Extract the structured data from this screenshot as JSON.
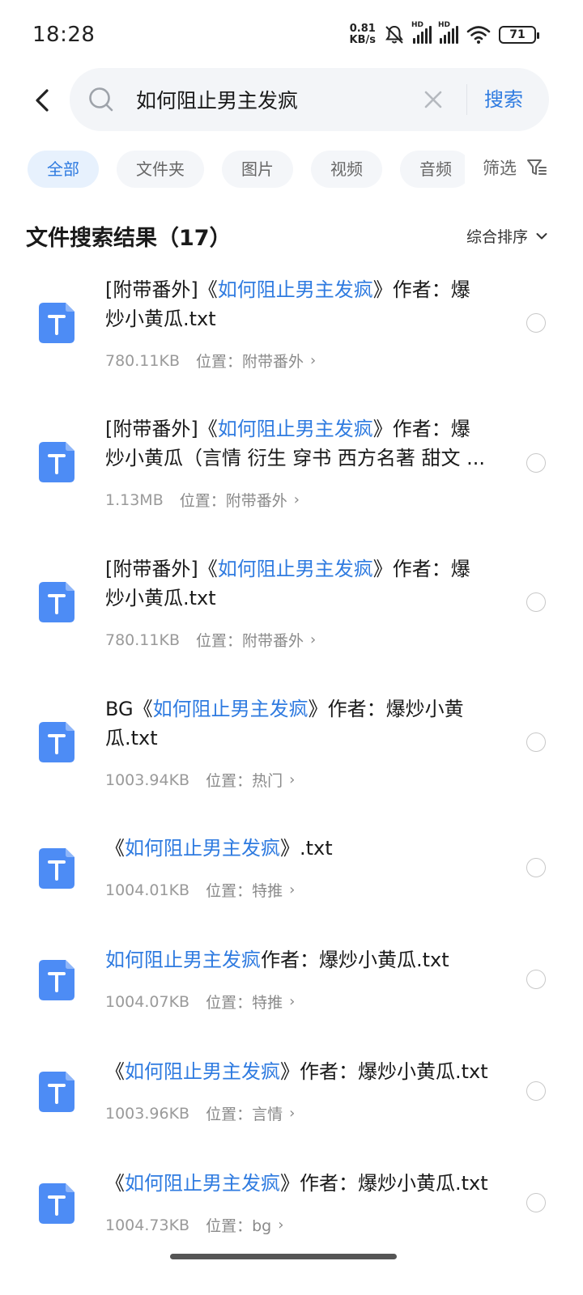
{
  "status_bar": {
    "time": "18:28",
    "net_speed_value": "0.81",
    "net_speed_unit": "KB/s",
    "hd1": "HD",
    "hd2": "HD",
    "battery": "71"
  },
  "search": {
    "query": "如何阻止男主发疯",
    "button_label": "搜索"
  },
  "tabs": [
    {
      "label": "全部",
      "active": true
    },
    {
      "label": "文件夹",
      "active": false
    },
    {
      "label": "图片",
      "active": false
    },
    {
      "label": "视频",
      "active": false
    },
    {
      "label": "音频",
      "active": false
    }
  ],
  "filter_label": "筛选",
  "results": {
    "title": "文件搜索结果（17）",
    "sort_label": "综合排序"
  },
  "colors": {
    "accent": "#2f7be0",
    "file_icon": "#4d8cf5"
  },
  "items": [
    {
      "title_line1_pre": "[附带番外]《",
      "title_line1_hl": "如何阻止男主发疯",
      "title_line1_post": "》作者：爆",
      "title_line2": "炒小黄瓜.txt",
      "size": "780.11KB",
      "location": "位置：附带番外"
    },
    {
      "title_line1_pre": "[附带番外]《",
      "title_line1_hl": "如何阻止男主发疯",
      "title_line1_post": "》作者：爆",
      "title_line2": "炒小黄瓜（言情 衍生 穿书 西方名著 甜文 ...",
      "size": "1.13MB",
      "location": "位置：附带番外"
    },
    {
      "title_line1_pre": "[附带番外]《",
      "title_line1_hl": "如何阻止男主发疯",
      "title_line1_post": "》作者：爆",
      "title_line2": "炒小黄瓜.txt",
      "size": "780.11KB",
      "location": "位置：附带番外"
    },
    {
      "title_line1_pre": "BG《",
      "title_line1_hl": "如何阻止男主发疯",
      "title_line1_post": "》作者：爆炒小黄",
      "title_line2": "瓜.txt",
      "size": "1003.94KB",
      "location": "位置：热门"
    },
    {
      "title_line1_pre": "《",
      "title_line1_hl": "如何阻止男主发疯",
      "title_line1_post": "》.txt",
      "title_line2": "",
      "size": "1004.01KB",
      "location": "位置：特推"
    },
    {
      "title_line1_pre": "",
      "title_line1_hl": "如何阻止男主发疯",
      "title_line1_post": "作者：爆炒小黄瓜.txt",
      "title_line2": "",
      "size": "1004.07KB",
      "location": "位置：特推"
    },
    {
      "title_line1_pre": "《",
      "title_line1_hl": "如何阻止男主发疯",
      "title_line1_post": "》作者：爆炒小黄瓜.txt",
      "title_line2": "",
      "size": "1003.96KB",
      "location": "位置：言情"
    },
    {
      "title_line1_pre": "《",
      "title_line1_hl": "如何阻止男主发疯",
      "title_line1_post": "》作者：爆炒小黄瓜.txt",
      "title_line2": "",
      "size": "1004.73KB",
      "location": "位置：bg"
    }
  ]
}
